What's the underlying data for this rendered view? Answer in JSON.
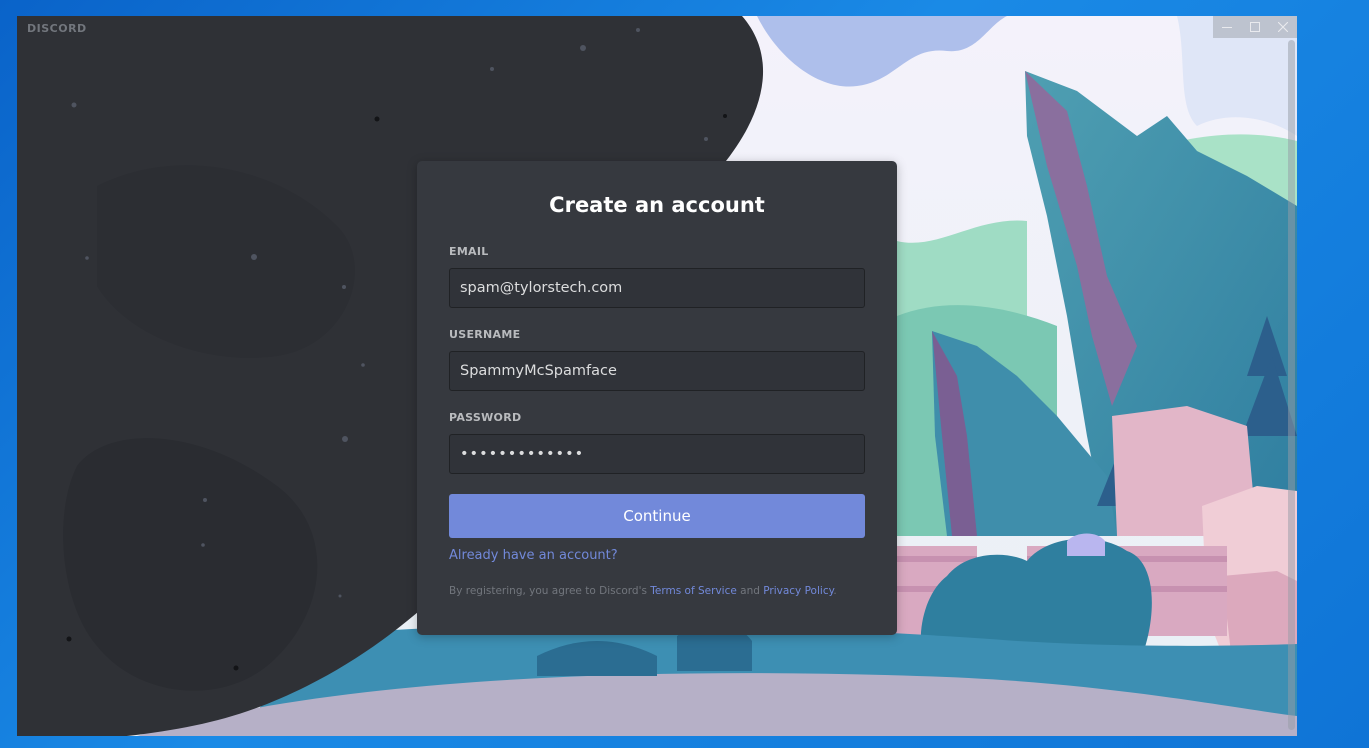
{
  "window": {
    "brand": "DISCORD",
    "controls": [
      "minimize-icon",
      "maximize-icon",
      "close-icon"
    ]
  },
  "auth": {
    "title": "Create an account",
    "email": {
      "label": "EMAIL",
      "value": "spam@tylorstech.com"
    },
    "username": {
      "label": "USERNAME",
      "value": "SpammyMcSpamface"
    },
    "password": {
      "label": "PASSWORD",
      "value": "spampassword1"
    },
    "continue_label": "Continue",
    "login_link": "Already have an account?",
    "legal": {
      "prefix": "By registering, you agree to Discord's ",
      "terms": "Terms of Service",
      "and": " and ",
      "privacy": "Privacy Policy",
      "suffix": "."
    }
  },
  "colors": {
    "card_bg": "#36393f",
    "input_bg": "#303339",
    "accent": "#7289da",
    "dark_bg": "#2f3136",
    "desktop": "#0f74d6"
  }
}
